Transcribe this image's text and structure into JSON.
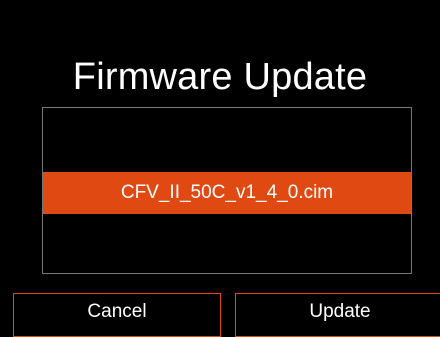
{
  "dialog": {
    "title": "Firmware Update"
  },
  "file_list": {
    "items": [
      {
        "name": "CFV_II_50C_v1_4_0.cim",
        "selected": true
      }
    ]
  },
  "buttons": {
    "cancel_label": "Cancel",
    "update_label": "Update"
  },
  "colors": {
    "background": "#000000",
    "accent": "#e04a12",
    "text": "#ffffff",
    "list_border": "#777777"
  }
}
